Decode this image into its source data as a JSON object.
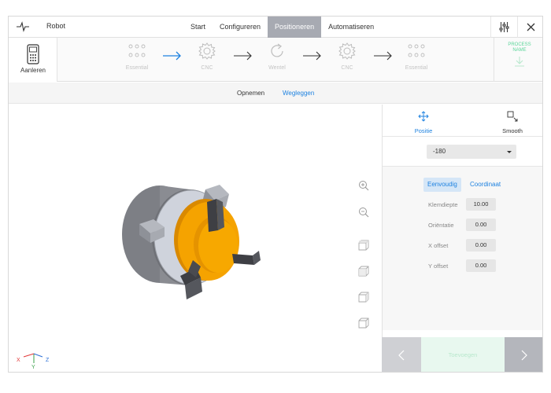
{
  "app": {
    "title": "Robot"
  },
  "nav": {
    "tabs": [
      "Start",
      "Configureren",
      "Positioneren",
      "Automatiseren"
    ],
    "active": "Positioneren"
  },
  "stepbar": {
    "teach_label": "Aanleren",
    "steps": [
      {
        "label": "Essential",
        "icon": "dots-grid-icon"
      },
      {
        "label": "CNC",
        "icon": "gear-icon"
      },
      {
        "label": "Wentel",
        "icon": "rotate-icon"
      },
      {
        "label": "CNC",
        "icon": "gear-icon"
      },
      {
        "label": "Essential",
        "icon": "dots-grid-icon"
      }
    ],
    "process_name": "PROCESS NAME"
  },
  "subtabs": {
    "opnemen": "Opnemen",
    "wegleggen": "Wegleggen",
    "active": "Wegleggen"
  },
  "panel": {
    "tab_positie": "Positie",
    "tab_smooth": "Smooth",
    "select_value": "-180",
    "mode_eenvoudig": "Eenvoudig",
    "mode_coordinaat": "Coordinaat",
    "fields": [
      {
        "label": "Klemdiepte",
        "value": "10.00"
      },
      {
        "label": "Oriëntatie",
        "value": "0.00"
      },
      {
        "label": "X offset",
        "value": "0.00"
      },
      {
        "label": "Y offset",
        "value": "0.00"
      }
    ],
    "footer_button": "Toevoegen"
  },
  "axes": {
    "x": "X",
    "y": "Y",
    "z": "Z"
  },
  "colors": {
    "accent": "#1e82e0",
    "active_tab": "#a7aab2",
    "part": "#f5a300",
    "green": "#5cd69a"
  }
}
